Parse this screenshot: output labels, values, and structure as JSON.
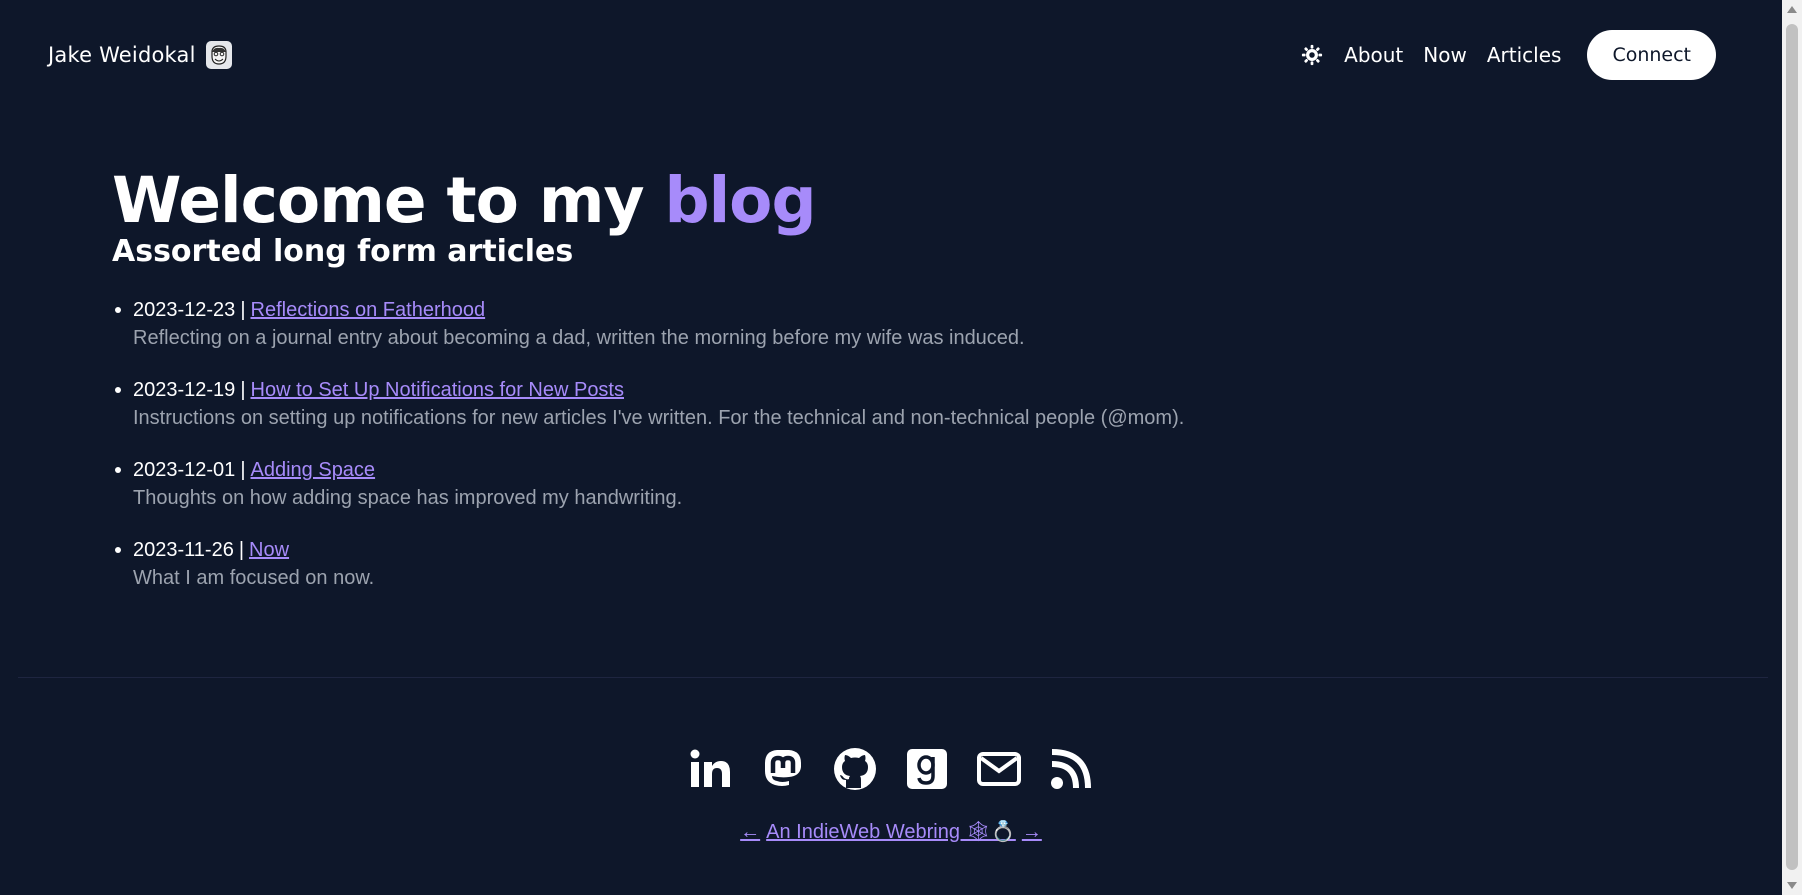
{
  "header": {
    "brand_name": "Jake Weidokal",
    "nav": [
      "About",
      "Now",
      "Articles"
    ],
    "connect_label": "Connect"
  },
  "hero": {
    "title_prefix": "Welcome to my ",
    "title_accent": "blog",
    "subtitle": "Assorted long form articles"
  },
  "articles": [
    {
      "date": "2023-12-23",
      "title": "Reflections on Fatherhood",
      "desc": "Reflecting on a journal entry about becoming a dad, written the morning before my wife was induced."
    },
    {
      "date": "2023-12-19",
      "title": "How to Set Up Notifications for New Posts",
      "desc": "Instructions on setting up notifications for new articles I've written. For the technical and non-technical people (@mom)."
    },
    {
      "date": "2023-12-01",
      "title": "Adding Space",
      "desc": "Thoughts on how adding space has improved my handwriting."
    },
    {
      "date": "2023-11-26",
      "title": "Now",
      "desc": "What I am focused on now."
    }
  ],
  "separator": "|",
  "footer": {
    "social_icons": [
      "linkedin-icon",
      "mastodon-icon",
      "github-icon",
      "goodreads-icon",
      "email-icon",
      "rss-icon"
    ],
    "webring_prev": "←",
    "webring_label": "An IndieWeb Webring 🕸💍",
    "webring_next": "→"
  },
  "colors": {
    "background": "#0e172a",
    "accent": "#a78bfa",
    "text": "#ffffff",
    "muted": "#9ca3af"
  }
}
